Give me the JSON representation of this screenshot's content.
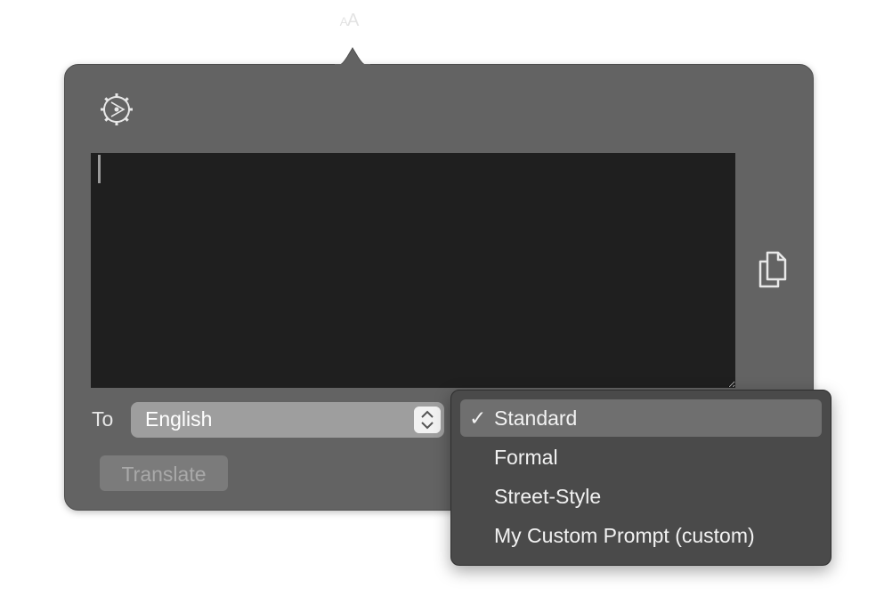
{
  "menubar": {
    "icon_name": "text-size-icon",
    "text_large": "A",
    "text_small": "A"
  },
  "popover": {
    "settings_icon": "gear-play-icon",
    "copy_icon": "copy-icon",
    "text_input_value": "",
    "to_label": "To",
    "language_select": {
      "value": "English"
    },
    "translate_button": "Translate"
  },
  "style_menu": {
    "check_mark": "✓",
    "items": [
      {
        "label": "Standard",
        "selected": true
      },
      {
        "label": "Formal",
        "selected": false
      },
      {
        "label": "Street-Style",
        "selected": false
      },
      {
        "label": "My Custom Prompt (custom)",
        "selected": false
      }
    ]
  }
}
